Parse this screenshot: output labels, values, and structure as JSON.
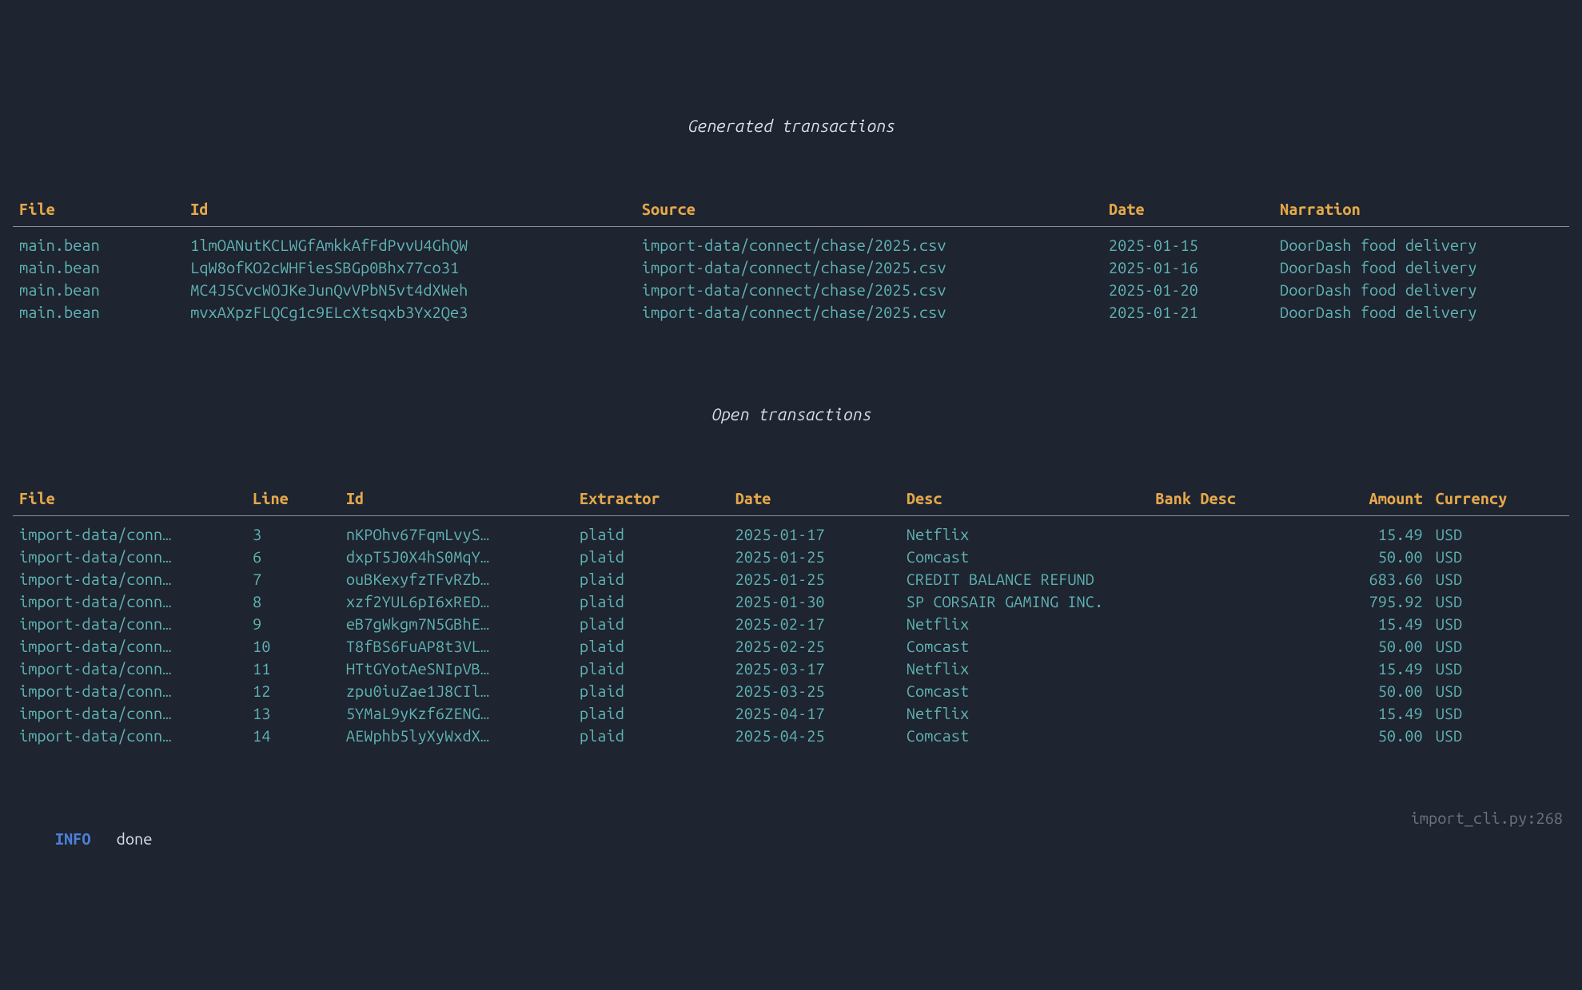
{
  "colors": {
    "background": "#1e2430",
    "header": "#e5a84b",
    "text": "#5fb3b3",
    "title": "#d8dee9",
    "log_level": "#4d7fd8",
    "rule": "#8a8f99",
    "muted": "#6b7280"
  },
  "sections": {
    "generated": {
      "title": "Generated transactions",
      "columns": [
        "File",
        "Id",
        "Source",
        "Date",
        "Narration"
      ],
      "rows": [
        {
          "file": "main.bean",
          "id": "1lmOANutKCLWGfAmkkAfFdPvvU4GhQW",
          "source": "import-data/connect/chase/2025.csv",
          "date": "2025-01-15",
          "narration": "DoorDash food delivery"
        },
        {
          "file": "main.bean",
          "id": "LqW8ofKO2cWHFiesSBGp0Bhx77co31",
          "source": "import-data/connect/chase/2025.csv",
          "date": "2025-01-16",
          "narration": "DoorDash food delivery"
        },
        {
          "file": "main.bean",
          "id": "MC4J5CvcWOJKeJunQvVPbN5vt4dXWeh",
          "source": "import-data/connect/chase/2025.csv",
          "date": "2025-01-20",
          "narration": "DoorDash food delivery"
        },
        {
          "file": "main.bean",
          "id": "mvxAXpzFLQCg1c9ELcXtsqxb3Yx2Qe3",
          "source": "import-data/connect/chase/2025.csv",
          "date": "2025-01-21",
          "narration": "DoorDash food delivery"
        }
      ]
    },
    "open": {
      "title": "Open transactions",
      "columns": [
        "File",
        "Line",
        "Id",
        "Extractor",
        "Date",
        "Desc",
        "Bank Desc",
        "Amount",
        "Currency"
      ],
      "rows": [
        {
          "file": "import-data/conn…",
          "line": "3",
          "id": "nKPOhv67FqmLvyS…",
          "extractor": "plaid",
          "date": "2025-01-17",
          "desc": "Netflix",
          "bank_desc": "",
          "amount": "15.49",
          "currency": "USD"
        },
        {
          "file": "import-data/conn…",
          "line": "6",
          "id": "dxpT5J0X4hS0MqY…",
          "extractor": "plaid",
          "date": "2025-01-25",
          "desc": "Comcast",
          "bank_desc": "",
          "amount": "50.00",
          "currency": "USD"
        },
        {
          "file": "import-data/conn…",
          "line": "7",
          "id": "ouBKexyfzTFvRZb…",
          "extractor": "plaid",
          "date": "2025-01-25",
          "desc": "CREDIT BALANCE REFUND",
          "bank_desc": "",
          "amount": "683.60",
          "currency": "USD"
        },
        {
          "file": "import-data/conn…",
          "line": "8",
          "id": "xzf2YUL6pI6xRED…",
          "extractor": "plaid",
          "date": "2025-01-30",
          "desc": "SP CORSAIR GAMING INC.",
          "bank_desc": "",
          "amount": "795.92",
          "currency": "USD"
        },
        {
          "file": "import-data/conn…",
          "line": "9",
          "id": "eB7gWkgm7N5GBhE…",
          "extractor": "plaid",
          "date": "2025-02-17",
          "desc": "Netflix",
          "bank_desc": "",
          "amount": "15.49",
          "currency": "USD"
        },
        {
          "file": "import-data/conn…",
          "line": "10",
          "id": "T8fBS6FuAP8t3VL…",
          "extractor": "plaid",
          "date": "2025-02-25",
          "desc": "Comcast",
          "bank_desc": "",
          "amount": "50.00",
          "currency": "USD"
        },
        {
          "file": "import-data/conn…",
          "line": "11",
          "id": "HTtGYotAeSNIpVB…",
          "extractor": "plaid",
          "date": "2025-03-17",
          "desc": "Netflix",
          "bank_desc": "",
          "amount": "15.49",
          "currency": "USD"
        },
        {
          "file": "import-data/conn…",
          "line": "12",
          "id": "zpu0iuZae1J8CIl…",
          "extractor": "plaid",
          "date": "2025-03-25",
          "desc": "Comcast",
          "bank_desc": "",
          "amount": "50.00",
          "currency": "USD"
        },
        {
          "file": "import-data/conn…",
          "line": "13",
          "id": "5YMaL9yKzf6ZENG…",
          "extractor": "plaid",
          "date": "2025-04-17",
          "desc": "Netflix",
          "bank_desc": "",
          "amount": "15.49",
          "currency": "USD"
        },
        {
          "file": "import-data/conn…",
          "line": "14",
          "id": "AEWphb5lyXyWxdX…",
          "extractor": "plaid",
          "date": "2025-04-25",
          "desc": "Comcast",
          "bank_desc": "",
          "amount": "50.00",
          "currency": "USD"
        }
      ]
    }
  },
  "footer": {
    "level": "INFO",
    "message": "done",
    "source": "import_cli.py:268"
  }
}
